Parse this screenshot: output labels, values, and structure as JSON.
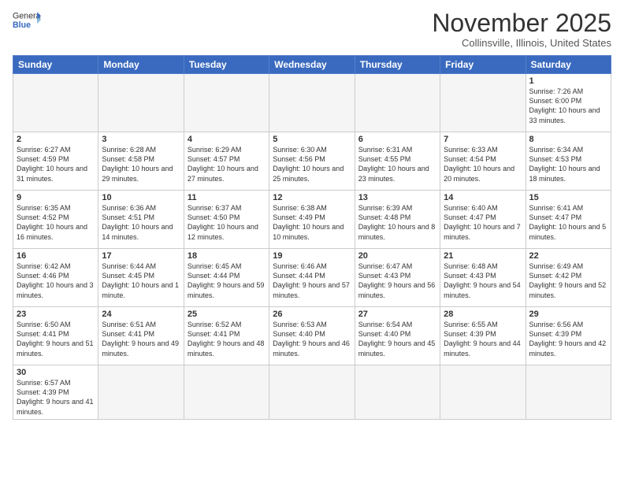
{
  "header": {
    "logo": {
      "general": "General",
      "blue": "Blue"
    },
    "title": "November 2025",
    "location": "Collinsville, Illinois, United States"
  },
  "days_of_week": [
    "Sunday",
    "Monday",
    "Tuesday",
    "Wednesday",
    "Thursday",
    "Friday",
    "Saturday"
  ],
  "weeks": [
    [
      {
        "day": null,
        "info": null
      },
      {
        "day": null,
        "info": null
      },
      {
        "day": null,
        "info": null
      },
      {
        "day": null,
        "info": null
      },
      {
        "day": null,
        "info": null
      },
      {
        "day": null,
        "info": null
      },
      {
        "day": "1",
        "info": "Sunrise: 7:26 AM\nSunset: 6:00 PM\nDaylight: 10 hours and 33 minutes."
      }
    ],
    [
      {
        "day": "2",
        "info": "Sunrise: 6:27 AM\nSunset: 4:59 PM\nDaylight: 10 hours and 31 minutes."
      },
      {
        "day": "3",
        "info": "Sunrise: 6:28 AM\nSunset: 4:58 PM\nDaylight: 10 hours and 29 minutes."
      },
      {
        "day": "4",
        "info": "Sunrise: 6:29 AM\nSunset: 4:57 PM\nDaylight: 10 hours and 27 minutes."
      },
      {
        "day": "5",
        "info": "Sunrise: 6:30 AM\nSunset: 4:56 PM\nDaylight: 10 hours and 25 minutes."
      },
      {
        "day": "6",
        "info": "Sunrise: 6:31 AM\nSunset: 4:55 PM\nDaylight: 10 hours and 23 minutes."
      },
      {
        "day": "7",
        "info": "Sunrise: 6:33 AM\nSunset: 4:54 PM\nDaylight: 10 hours and 20 minutes."
      },
      {
        "day": "8",
        "info": "Sunrise: 6:34 AM\nSunset: 4:53 PM\nDaylight: 10 hours and 18 minutes."
      }
    ],
    [
      {
        "day": "9",
        "info": "Sunrise: 6:35 AM\nSunset: 4:52 PM\nDaylight: 10 hours and 16 minutes."
      },
      {
        "day": "10",
        "info": "Sunrise: 6:36 AM\nSunset: 4:51 PM\nDaylight: 10 hours and 14 minutes."
      },
      {
        "day": "11",
        "info": "Sunrise: 6:37 AM\nSunset: 4:50 PM\nDaylight: 10 hours and 12 minutes."
      },
      {
        "day": "12",
        "info": "Sunrise: 6:38 AM\nSunset: 4:49 PM\nDaylight: 10 hours and 10 minutes."
      },
      {
        "day": "13",
        "info": "Sunrise: 6:39 AM\nSunset: 4:48 PM\nDaylight: 10 hours and 8 minutes."
      },
      {
        "day": "14",
        "info": "Sunrise: 6:40 AM\nSunset: 4:47 PM\nDaylight: 10 hours and 7 minutes."
      },
      {
        "day": "15",
        "info": "Sunrise: 6:41 AM\nSunset: 4:47 PM\nDaylight: 10 hours and 5 minutes."
      }
    ],
    [
      {
        "day": "16",
        "info": "Sunrise: 6:42 AM\nSunset: 4:46 PM\nDaylight: 10 hours and 3 minutes."
      },
      {
        "day": "17",
        "info": "Sunrise: 6:44 AM\nSunset: 4:45 PM\nDaylight: 10 hours and 1 minute."
      },
      {
        "day": "18",
        "info": "Sunrise: 6:45 AM\nSunset: 4:44 PM\nDaylight: 9 hours and 59 minutes."
      },
      {
        "day": "19",
        "info": "Sunrise: 6:46 AM\nSunset: 4:44 PM\nDaylight: 9 hours and 57 minutes."
      },
      {
        "day": "20",
        "info": "Sunrise: 6:47 AM\nSunset: 4:43 PM\nDaylight: 9 hours and 56 minutes."
      },
      {
        "day": "21",
        "info": "Sunrise: 6:48 AM\nSunset: 4:43 PM\nDaylight: 9 hours and 54 minutes."
      },
      {
        "day": "22",
        "info": "Sunrise: 6:49 AM\nSunset: 4:42 PM\nDaylight: 9 hours and 52 minutes."
      }
    ],
    [
      {
        "day": "23",
        "info": "Sunrise: 6:50 AM\nSunset: 4:41 PM\nDaylight: 9 hours and 51 minutes."
      },
      {
        "day": "24",
        "info": "Sunrise: 6:51 AM\nSunset: 4:41 PM\nDaylight: 9 hours and 49 minutes."
      },
      {
        "day": "25",
        "info": "Sunrise: 6:52 AM\nSunset: 4:41 PM\nDaylight: 9 hours and 48 minutes."
      },
      {
        "day": "26",
        "info": "Sunrise: 6:53 AM\nSunset: 4:40 PM\nDaylight: 9 hours and 46 minutes."
      },
      {
        "day": "27",
        "info": "Sunrise: 6:54 AM\nSunset: 4:40 PM\nDaylight: 9 hours and 45 minutes."
      },
      {
        "day": "28",
        "info": "Sunrise: 6:55 AM\nSunset: 4:39 PM\nDaylight: 9 hours and 44 minutes."
      },
      {
        "day": "29",
        "info": "Sunrise: 6:56 AM\nSunset: 4:39 PM\nDaylight: 9 hours and 42 minutes."
      }
    ],
    [
      {
        "day": "30",
        "info": "Sunrise: 6:57 AM\nSunset: 4:39 PM\nDaylight: 9 hours and 41 minutes."
      },
      {
        "day": null,
        "info": null
      },
      {
        "day": null,
        "info": null
      },
      {
        "day": null,
        "info": null
      },
      {
        "day": null,
        "info": null
      },
      {
        "day": null,
        "info": null
      },
      {
        "day": null,
        "info": null
      }
    ]
  ]
}
